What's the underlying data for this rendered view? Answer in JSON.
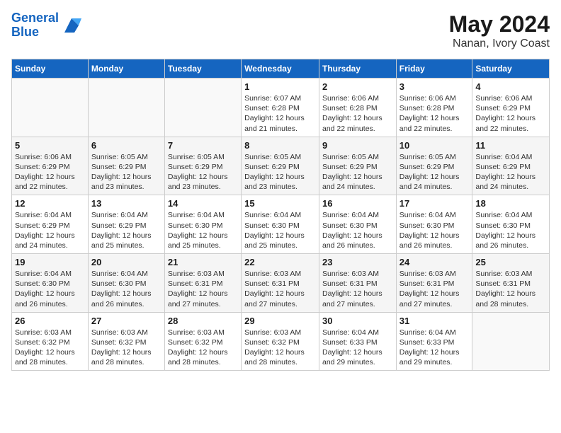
{
  "header": {
    "logo_line1": "General",
    "logo_line2": "Blue",
    "title": "May 2024",
    "subtitle": "Nanan, Ivory Coast"
  },
  "days_of_week": [
    "Sunday",
    "Monday",
    "Tuesday",
    "Wednesday",
    "Thursday",
    "Friday",
    "Saturday"
  ],
  "weeks": [
    [
      {
        "day": "",
        "info": ""
      },
      {
        "day": "",
        "info": ""
      },
      {
        "day": "",
        "info": ""
      },
      {
        "day": "1",
        "info": "Sunrise: 6:07 AM\nSunset: 6:28 PM\nDaylight: 12 hours and 21 minutes."
      },
      {
        "day": "2",
        "info": "Sunrise: 6:06 AM\nSunset: 6:28 PM\nDaylight: 12 hours and 22 minutes."
      },
      {
        "day": "3",
        "info": "Sunrise: 6:06 AM\nSunset: 6:28 PM\nDaylight: 12 hours and 22 minutes."
      },
      {
        "day": "4",
        "info": "Sunrise: 6:06 AM\nSunset: 6:29 PM\nDaylight: 12 hours and 22 minutes."
      }
    ],
    [
      {
        "day": "5",
        "info": "Sunrise: 6:06 AM\nSunset: 6:29 PM\nDaylight: 12 hours and 22 minutes."
      },
      {
        "day": "6",
        "info": "Sunrise: 6:05 AM\nSunset: 6:29 PM\nDaylight: 12 hours and 23 minutes."
      },
      {
        "day": "7",
        "info": "Sunrise: 6:05 AM\nSunset: 6:29 PM\nDaylight: 12 hours and 23 minutes."
      },
      {
        "day": "8",
        "info": "Sunrise: 6:05 AM\nSunset: 6:29 PM\nDaylight: 12 hours and 23 minutes."
      },
      {
        "day": "9",
        "info": "Sunrise: 6:05 AM\nSunset: 6:29 PM\nDaylight: 12 hours and 24 minutes."
      },
      {
        "day": "10",
        "info": "Sunrise: 6:05 AM\nSunset: 6:29 PM\nDaylight: 12 hours and 24 minutes."
      },
      {
        "day": "11",
        "info": "Sunrise: 6:04 AM\nSunset: 6:29 PM\nDaylight: 12 hours and 24 minutes."
      }
    ],
    [
      {
        "day": "12",
        "info": "Sunrise: 6:04 AM\nSunset: 6:29 PM\nDaylight: 12 hours and 24 minutes."
      },
      {
        "day": "13",
        "info": "Sunrise: 6:04 AM\nSunset: 6:29 PM\nDaylight: 12 hours and 25 minutes."
      },
      {
        "day": "14",
        "info": "Sunrise: 6:04 AM\nSunset: 6:30 PM\nDaylight: 12 hours and 25 minutes."
      },
      {
        "day": "15",
        "info": "Sunrise: 6:04 AM\nSunset: 6:30 PM\nDaylight: 12 hours and 25 minutes."
      },
      {
        "day": "16",
        "info": "Sunrise: 6:04 AM\nSunset: 6:30 PM\nDaylight: 12 hours and 26 minutes."
      },
      {
        "day": "17",
        "info": "Sunrise: 6:04 AM\nSunset: 6:30 PM\nDaylight: 12 hours and 26 minutes."
      },
      {
        "day": "18",
        "info": "Sunrise: 6:04 AM\nSunset: 6:30 PM\nDaylight: 12 hours and 26 minutes."
      }
    ],
    [
      {
        "day": "19",
        "info": "Sunrise: 6:04 AM\nSunset: 6:30 PM\nDaylight: 12 hours and 26 minutes."
      },
      {
        "day": "20",
        "info": "Sunrise: 6:04 AM\nSunset: 6:30 PM\nDaylight: 12 hours and 26 minutes."
      },
      {
        "day": "21",
        "info": "Sunrise: 6:03 AM\nSunset: 6:31 PM\nDaylight: 12 hours and 27 minutes."
      },
      {
        "day": "22",
        "info": "Sunrise: 6:03 AM\nSunset: 6:31 PM\nDaylight: 12 hours and 27 minutes."
      },
      {
        "day": "23",
        "info": "Sunrise: 6:03 AM\nSunset: 6:31 PM\nDaylight: 12 hours and 27 minutes."
      },
      {
        "day": "24",
        "info": "Sunrise: 6:03 AM\nSunset: 6:31 PM\nDaylight: 12 hours and 27 minutes."
      },
      {
        "day": "25",
        "info": "Sunrise: 6:03 AM\nSunset: 6:31 PM\nDaylight: 12 hours and 28 minutes."
      }
    ],
    [
      {
        "day": "26",
        "info": "Sunrise: 6:03 AM\nSunset: 6:32 PM\nDaylight: 12 hours and 28 minutes."
      },
      {
        "day": "27",
        "info": "Sunrise: 6:03 AM\nSunset: 6:32 PM\nDaylight: 12 hours and 28 minutes."
      },
      {
        "day": "28",
        "info": "Sunrise: 6:03 AM\nSunset: 6:32 PM\nDaylight: 12 hours and 28 minutes."
      },
      {
        "day": "29",
        "info": "Sunrise: 6:03 AM\nSunset: 6:32 PM\nDaylight: 12 hours and 28 minutes."
      },
      {
        "day": "30",
        "info": "Sunrise: 6:04 AM\nSunset: 6:33 PM\nDaylight: 12 hours and 29 minutes."
      },
      {
        "day": "31",
        "info": "Sunrise: 6:04 AM\nSunset: 6:33 PM\nDaylight: 12 hours and 29 minutes."
      },
      {
        "day": "",
        "info": ""
      }
    ]
  ]
}
